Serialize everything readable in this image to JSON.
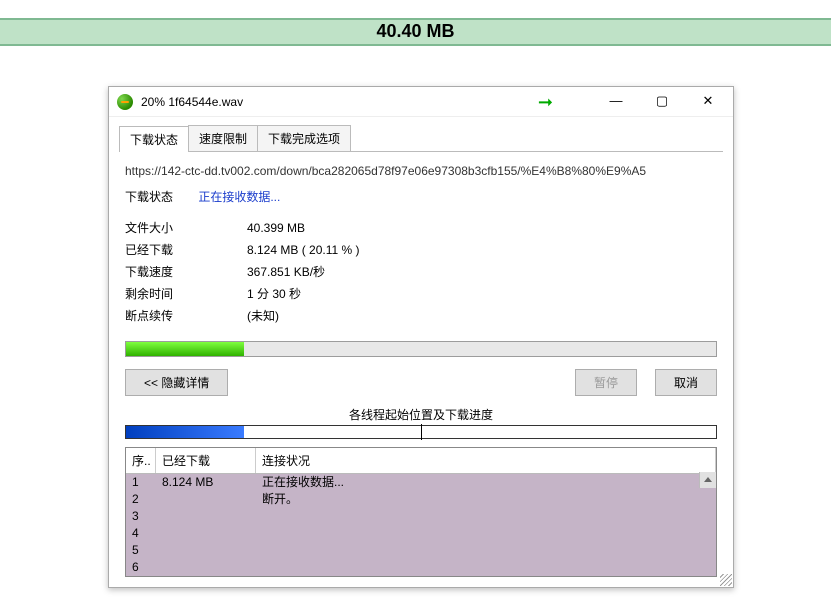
{
  "banner": "40.40 MB",
  "window": {
    "title": "20% 1f64544e.wav"
  },
  "tabs": {
    "status": "下载状态",
    "speedlimit": "速度限制",
    "complete": "下载完成选项"
  },
  "url": "https://142-ctc-dd.tv002.com/down/bca282065d78f97e06e97308b3cfb155/%E4%B8%80%E9%A5",
  "status": {
    "label": "下载状态",
    "value": "正在接收数据..."
  },
  "info": {
    "size_label": "文件大小",
    "size_value": "40.399  MB",
    "done_label": "已经下载",
    "done_value": "8.124  MB   ( 20.11 % )",
    "speed_label": "下载速度",
    "speed_value": "367.851  KB/秒",
    "eta_label": "剩余时间",
    "eta_value": "1 分 30 秒",
    "resume_label": "断点续传",
    "resume_value": "(未知)"
  },
  "progress_percent": 20,
  "buttons": {
    "hide": "<< 隐藏详情",
    "pause": "暂停",
    "cancel": "取消"
  },
  "segments_title": "各线程起始位置及下载进度",
  "thread_header": {
    "idx": "序..",
    "downloaded": "已经下载",
    "conn": "连接状况"
  },
  "threads": [
    {
      "idx": "1",
      "downloaded": "8.124 MB",
      "conn": "正在接收数据..."
    },
    {
      "idx": "2",
      "downloaded": "",
      "conn": "断开。"
    },
    {
      "idx": "3",
      "downloaded": "",
      "conn": ""
    },
    {
      "idx": "4",
      "downloaded": "",
      "conn": ""
    },
    {
      "idx": "5",
      "downloaded": "",
      "conn": ""
    },
    {
      "idx": "6",
      "downloaded": "",
      "conn": ""
    }
  ]
}
